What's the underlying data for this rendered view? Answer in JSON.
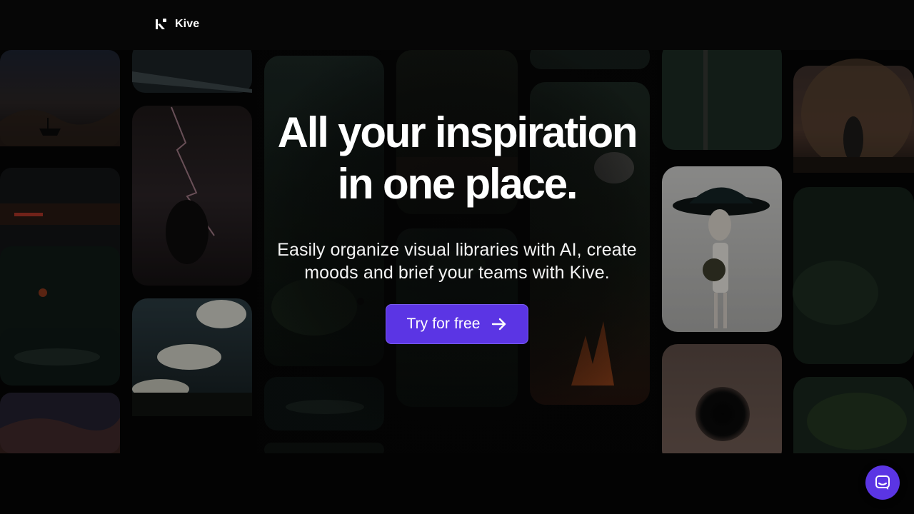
{
  "header": {
    "brand_name": "Kive",
    "logo_icon": "kive-logo-icon"
  },
  "hero": {
    "title_line_1": "All your inspiration",
    "title_line_2": "in one place.",
    "subtitle": "Easily organize visual libraries with AI, create moods and brief your teams with Kive.",
    "cta_label": "Try for free",
    "cta_icon": "arrow-right-icon"
  },
  "gallery": {
    "images": [
      "storm-ship-image",
      "lightning-creature-image",
      "forest-giant-image",
      "forest-spaceship-image",
      "alien-figure-image",
      "forest-waterfall-image",
      "cloud-city-image",
      "burning-forest-image",
      "eye-face-image",
      "night-fire-forest-image",
      "sunset-giant-image"
    ]
  },
  "chat": {
    "icon": "chat-bubble-icon"
  },
  "colors": {
    "background": "#050505",
    "accent": "#5b35e4",
    "text": "#ffffff"
  }
}
